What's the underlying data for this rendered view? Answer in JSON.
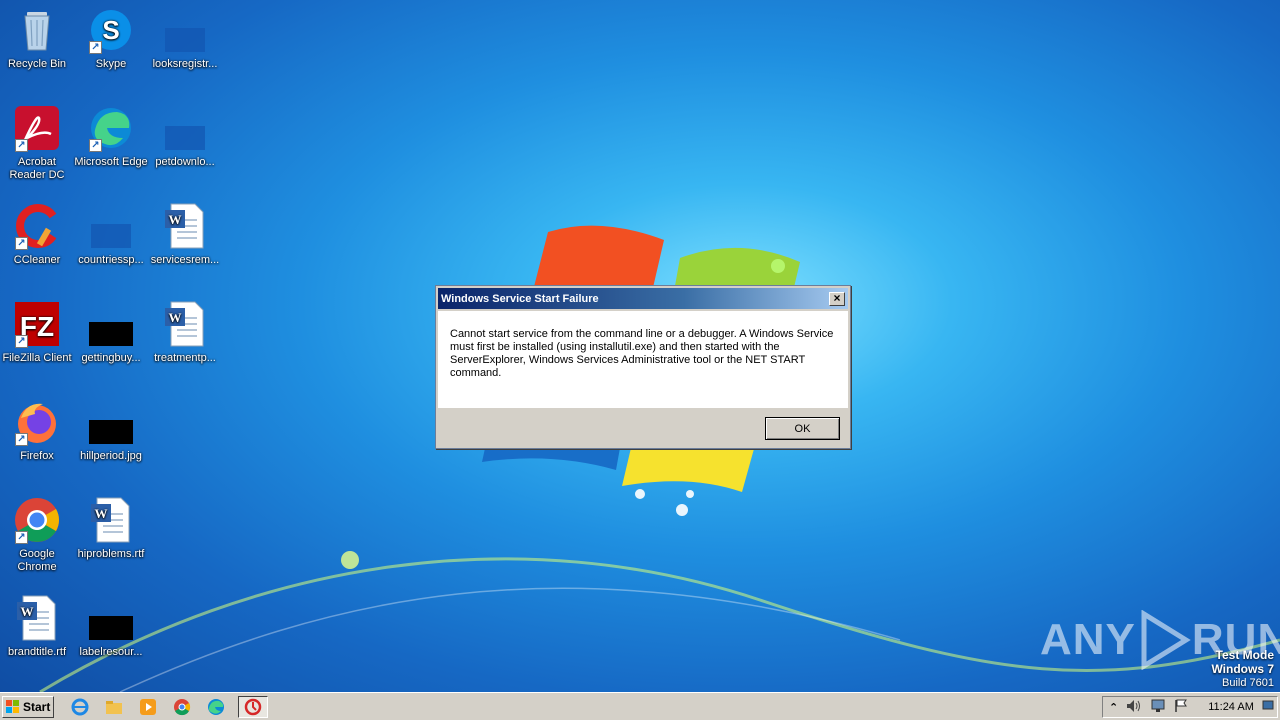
{
  "desktop": {
    "icons": [
      {
        "label": "Recycle Bin"
      },
      {
        "label": "Skype"
      },
      {
        "label": "looksregistr..."
      },
      {
        "label": "Acrobat Reader DC"
      },
      {
        "label": "Microsoft Edge"
      },
      {
        "label": "petdownlo..."
      },
      {
        "label": "CCleaner"
      },
      {
        "label": "countriessp..."
      },
      {
        "label": "servicesrem..."
      },
      {
        "label": "FileZilla Client"
      },
      {
        "label": "gettingbuy..."
      },
      {
        "label": "treatmentp..."
      },
      {
        "label": "Firefox"
      },
      {
        "label": "hillperiod.jpg"
      },
      {
        "label": "Google Chrome"
      },
      {
        "label": "hiproblems.rtf"
      },
      {
        "label": "brandtitle.rtf"
      },
      {
        "label": "labelresour..."
      }
    ]
  },
  "dialog": {
    "title": "Windows Service Start Failure",
    "close_label": "×",
    "message": "Cannot start service from the command line or a debugger.  A Windows Service must first be installed (using installutil.exe) and then started with the ServerExplorer, Windows Services Administrative tool or the NET START command.",
    "ok_label": "OK"
  },
  "watermark": {
    "left": "ANY",
    "right": "RUN"
  },
  "os_info": {
    "line1": "Test Mode",
    "line2": "Windows 7",
    "line3": "Build 7601"
  },
  "taskbar": {
    "start_label": "Start",
    "clock": "11:24 AM"
  },
  "colors": {
    "titlebar_start": "#0a246a",
    "titlebar_end": "#a6caf0",
    "system_face": "#d4d0c8"
  }
}
